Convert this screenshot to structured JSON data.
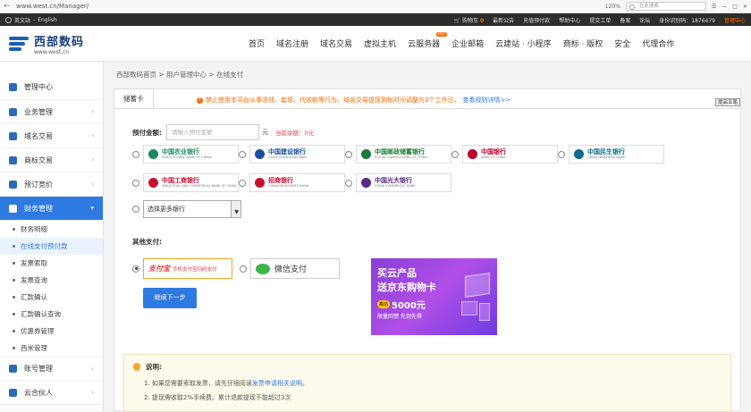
{
  "browser": {
    "url": "www.west.cn/Manager/",
    "zoom": "120%",
    "search_placeholder": "在此搜索"
  },
  "topbar": {
    "lang_cn": "英文站",
    "lang_en": "English",
    "cart_label": "购物车",
    "cart_count": "0",
    "links": [
      "最新公告",
      "充值预付款",
      "帮助中心",
      "提交工单",
      "备案",
      "论坛",
      "身份识别码：1876479"
    ],
    "admin": "管理中心"
  },
  "header": {
    "logo_cn": "西部数码",
    "logo_en": "www.west.cn",
    "nav": [
      "首页",
      "域名注册",
      "域名交易",
      "虚拟主机",
      "云服务器",
      "企业邮箱",
      "云建站 · 小程序",
      "商标 · 版权",
      "安全",
      "代理合作"
    ],
    "hot_badge": "HOT"
  },
  "sidebar": {
    "home": "管理中心",
    "items_top": [
      "业务管理",
      "域名交易",
      "商标交易",
      "预订竞价"
    ],
    "active": "财务管理",
    "sub_items": [
      "财务明细",
      "在线支付预付款",
      "发票索取",
      "发票查询",
      "汇款确认",
      "汇款确认查询",
      "优惠券管理",
      "西米管理"
    ],
    "items_bottom": [
      "账号管理",
      "云合伙人"
    ]
  },
  "breadcrumb": "西部数码首页 > 用户管理中心 > 在线支付",
  "panel": {
    "tab": "储蓄卡",
    "notice": "禁止使用本平台从事洗钱、套现、代收款等行为。域名交易提现到帐时间调整为3个工作日。",
    "notice_link": "查看规则详情>>",
    "cut_button": "提品五笔",
    "amount_label": "预付金额:",
    "amount_placeholder": "请输入预付金额",
    "amount_unit": "元",
    "balance": "当前余额：0元",
    "banks": [
      {
        "cn": "中国农业银行",
        "en": "AGRICULTURAL BANK OF CHINA",
        "color": "#1a8a5a"
      },
      {
        "cn": "中国建设银行",
        "en": "China Construction Bank",
        "color": "#1a4fa0"
      },
      {
        "cn": "中国邮政储蓄银行",
        "en": "POSTAL SAVINGS BANK OF CHINA",
        "color": "#1a7a3a"
      },
      {
        "cn": "中国银行",
        "en": "BANK OF CHINA",
        "color": "#b8002a"
      },
      {
        "cn": "中国民生银行",
        "en": "CHINA MINSHENG BANK",
        "color": "#0a6a8a"
      },
      {
        "cn": "中国工商银行",
        "en": "INDUSTRIAL AND COMMERCIAL BANK OF CHINA",
        "color": "#c8102e"
      },
      {
        "cn": "招商银行",
        "en": "CHINA MERCHANTS BANK",
        "color": "#c8102e"
      },
      {
        "cn": "中国光大银行",
        "en": "CHINA EVERBRIGHT BANK",
        "color": "#5a2a8a"
      }
    ],
    "more_banks": "选择更多银行",
    "other_title": "其他支付:",
    "alipay_logo": "支付宝",
    "alipay_text": "手机支付宝扫码支付",
    "wechat_text": "微信支付",
    "next_button": "继续下一步",
    "ad": {
      "line1": "买云产品",
      "line2": "送京东购物卡",
      "pill": "高达",
      "amount": "5000元",
      "line4": "限量回馈 先到先得"
    },
    "note": {
      "title": "说明:",
      "line1": "1. 如果您需要索取发票，请先仔细阅读",
      "line1_link": "发票申请相关说明",
      "line1_tail": "。",
      "line2": "2. 提现需收取2%手续费。累计退款提现不能超过3次"
    }
  }
}
